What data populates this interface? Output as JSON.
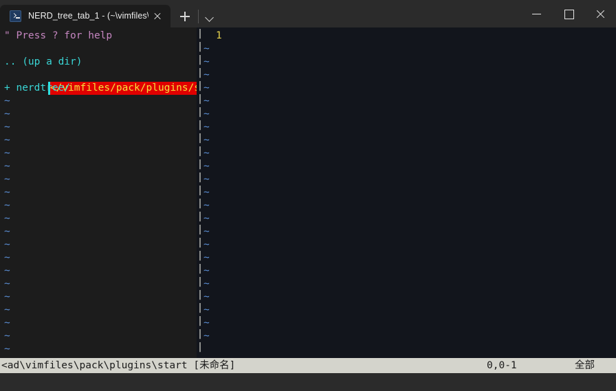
{
  "window": {
    "tab": {
      "icon": "powershell-icon",
      "title": "NERD_tree_tab_1 - (~\\vimfiles\\",
      "close_label": "×"
    },
    "newtab_label": "+",
    "tabmenu_label": "⌄",
    "controls": {
      "minimize": "—",
      "maximize": "□",
      "close": "✕"
    },
    "colors": {
      "titlebar_bg": "#2b2b2b",
      "active_tab_bg": "#1c1c1c",
      "nerdtree_bg": "#1c1c1c",
      "editor_bg": "#12151c",
      "statusline_bg": "#d4d4cc",
      "highlight_bg": "#e00000",
      "highlight_fg": "#f5e03c",
      "cursor": "#30e0e0"
    }
  },
  "nerdtree": {
    "help_hint": "\" Press ? for help",
    "blank": "",
    "up_a_dir": ".. (up a dir)",
    "current_path": "</vimfiles/pack/plugins/start/",
    "current_path_arrow": "<",
    "current_path_rest": "/vimfiles/pack/plugins/start/",
    "child_entry": "+ nerdtree/",
    "tilde": "~",
    "tilde_count": 20
  },
  "editor": {
    "line_number": "1",
    "tilde": "~",
    "tilde_count": 23,
    "separator_char": "|",
    "separator_count": 25
  },
  "statusline": {
    "path": "<ad\\vimfiles\\pack\\plugins\\start",
    "buffer_name": "[未命名]",
    "position": "0,0-1",
    "scroll_state": "全部"
  }
}
